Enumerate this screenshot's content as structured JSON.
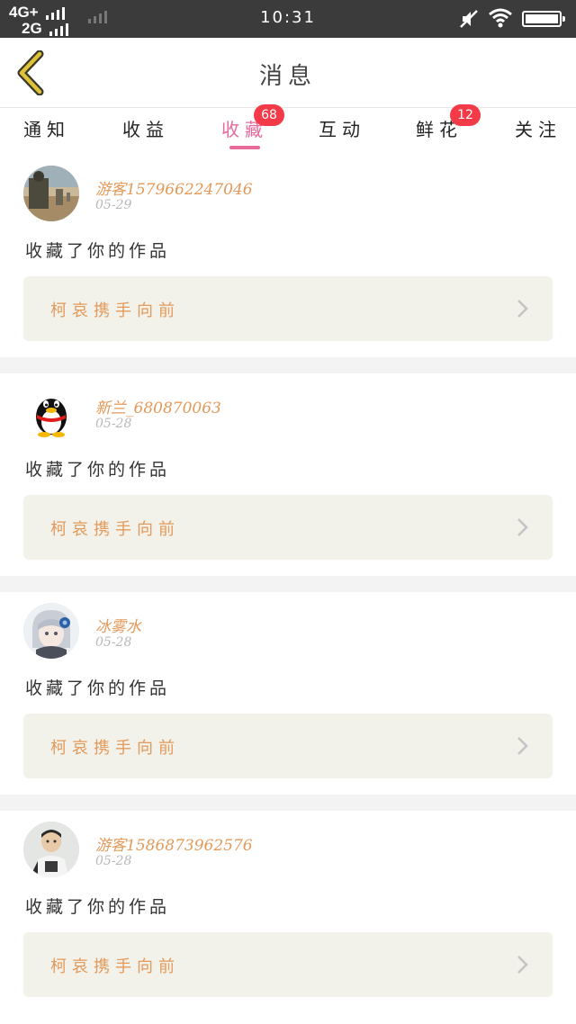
{
  "status_bar": {
    "network_top": "4G+",
    "network_bottom": "2G",
    "time": "10:31",
    "icons": [
      "signal-bars-icon",
      "mute-icon",
      "wifi-icon",
      "battery-icon"
    ]
  },
  "header": {
    "title": "消息",
    "back_icon": "chevron-left-icon",
    "accent_color": "#e0c238"
  },
  "tabs": [
    {
      "label": "通知",
      "badge": ""
    },
    {
      "label": "收益",
      "badge": ""
    },
    {
      "label": "收藏",
      "badge": "68",
      "active": true
    },
    {
      "label": "互动",
      "badge": ""
    },
    {
      "label": "鲜花",
      "badge": "12"
    },
    {
      "label": "关注",
      "badge": ""
    }
  ],
  "colors": {
    "active_tab": "#e8699b",
    "badge": "#f33a48",
    "username": "#e39a5a",
    "work_card_bg": "#f2f1ea"
  },
  "feed": [
    {
      "username": "游客15796622470​46",
      "date": "05-29",
      "action": "收藏了你的作品",
      "work_title": "柯哀携手向前",
      "avatar": "photo-avatar"
    },
    {
      "username": "新兰_68087006​3",
      "date": "05-28",
      "action": "收藏了你的作品",
      "work_title": "柯哀携手向前",
      "avatar": "qq-penguin-avatar"
    },
    {
      "username": "冰雾水",
      "date": "05-28",
      "action": "收藏了你的作品",
      "work_title": "柯哀携手向前",
      "avatar": "anime-avatar"
    },
    {
      "username": "游客15868739625​76",
      "date": "05-28",
      "action": "收藏了你的作品",
      "work_title": "柯哀携手向前",
      "avatar": "person-avatar"
    }
  ]
}
